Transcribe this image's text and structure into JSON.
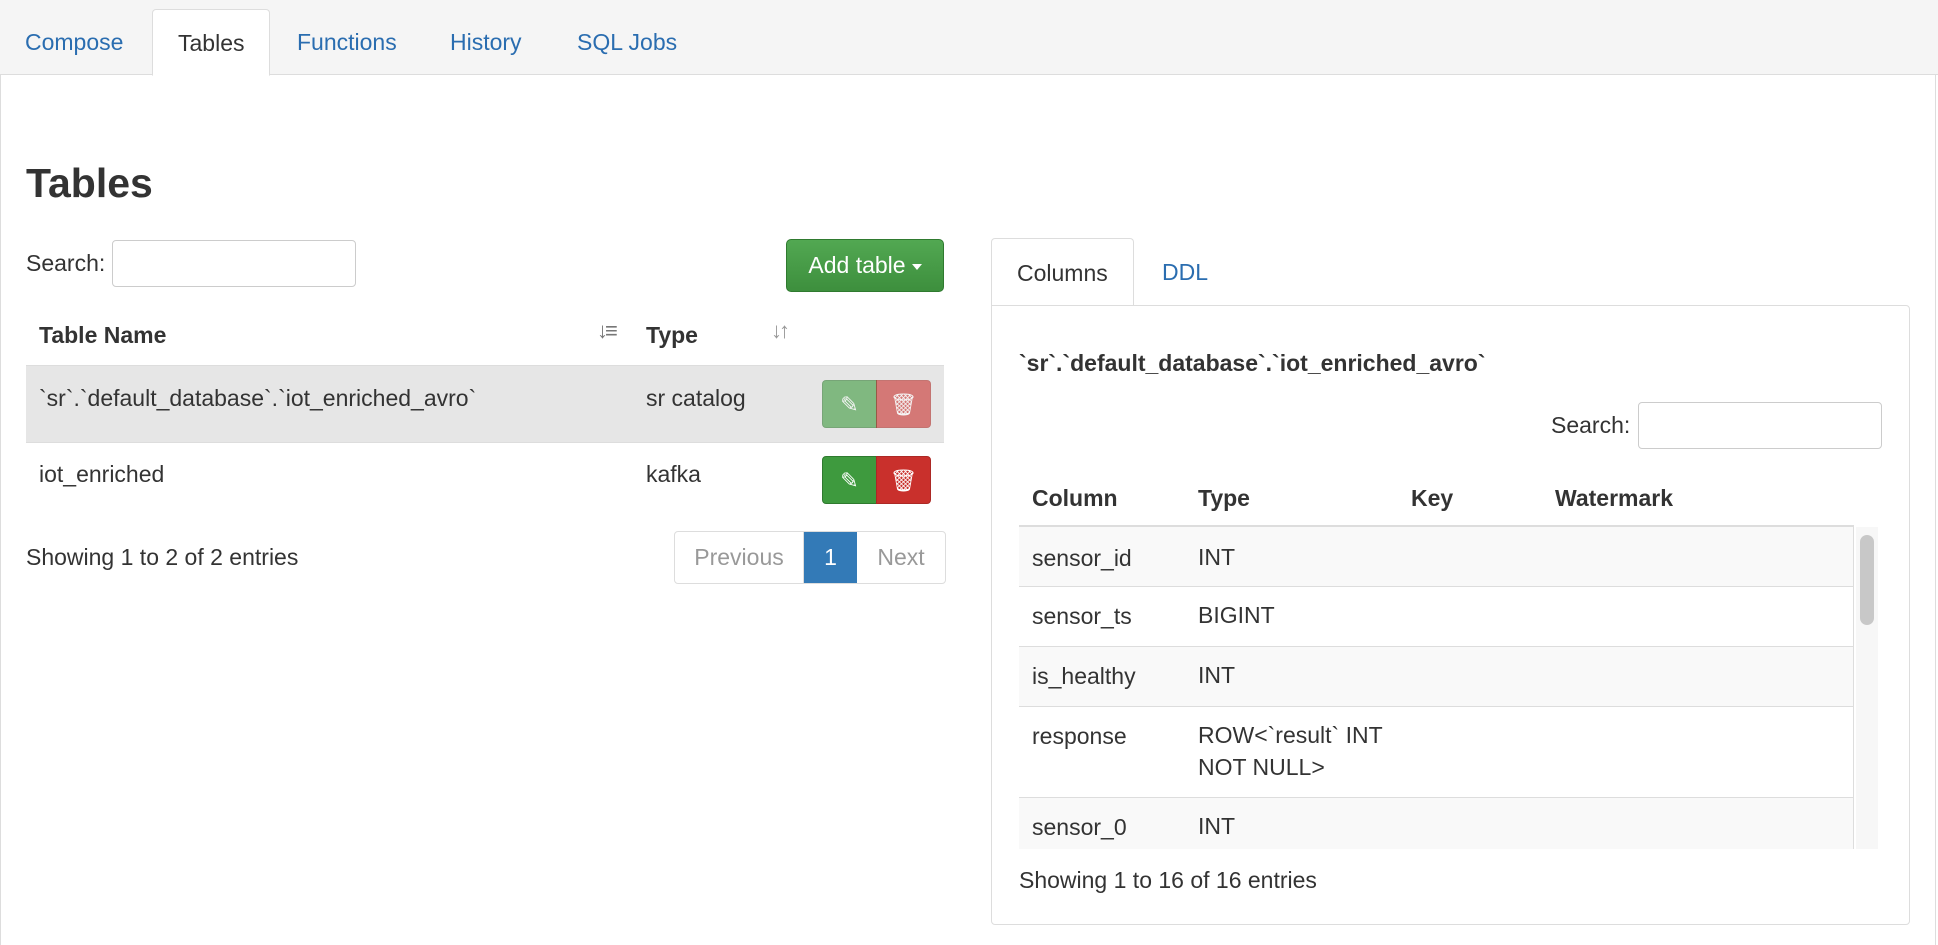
{
  "top_tabs": [
    "Compose",
    "Tables",
    "Functions",
    "History",
    "SQL Jobs"
  ],
  "page_title": "Tables",
  "left": {
    "search_label": "Search:",
    "search_value": "",
    "add_button": "Add table",
    "headers": [
      "Table Name",
      "Type"
    ],
    "rows": [
      {
        "name": "`sr`.`default_database`.`iot_enriched_avro`",
        "type": "sr catalog"
      },
      {
        "name": "iot_enriched",
        "type": "kafka"
      }
    ],
    "info": "Showing 1 to 2 of 2 entries",
    "pager": {
      "previous": "Previous",
      "page": "1",
      "next": "Next"
    }
  },
  "right": {
    "tabs": [
      "Columns",
      "DDL"
    ],
    "table_title": "`sr`.`default_database`.`iot_enriched_avro`",
    "search_label": "Search:",
    "search_value": "",
    "headers": [
      "Column",
      "Type",
      "Key",
      "Watermark"
    ],
    "rows": [
      {
        "column": "sensor_id",
        "type": "INT"
      },
      {
        "column": "sensor_ts",
        "type": "BIGINT"
      },
      {
        "column": "is_healthy",
        "type": "INT"
      },
      {
        "column": "response",
        "type": "ROW<`result` INT NOT NULL>"
      },
      {
        "column": "sensor_0",
        "type": "INT"
      }
    ],
    "info": "Showing 1 to 16 of 16 entries"
  },
  "icons": {
    "edit": "pencil-icon",
    "delete": "trash-icon",
    "sort": "sort-icon"
  },
  "colors": {
    "link": "#2a6db0",
    "success": "#3e9a3e",
    "danger": "#c9302c",
    "primary": "#337ab7"
  }
}
